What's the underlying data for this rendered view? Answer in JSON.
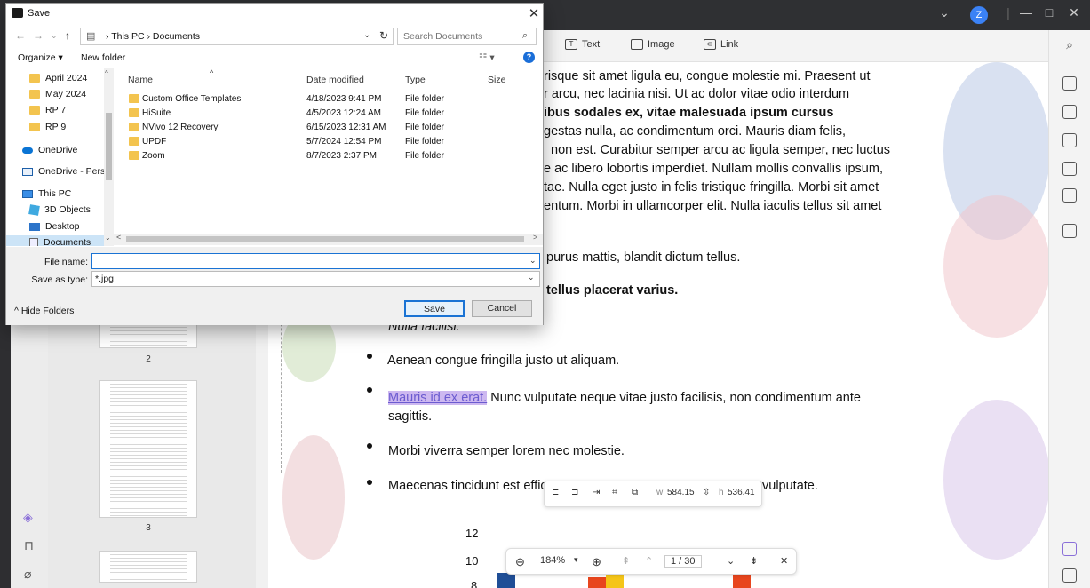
{
  "dialog": {
    "title": "Save",
    "address": {
      "path": "› This PC › Documents",
      "search_placeholder": "Search Documents"
    },
    "commands": {
      "organize": "Organize ▾",
      "new_folder": "New folder"
    },
    "nav_items": [
      {
        "label": "April 2024",
        "icon": "folder-icon"
      },
      {
        "label": "May 2024",
        "icon": "folder-icon"
      },
      {
        "label": "RP 7",
        "icon": "folder-icon"
      },
      {
        "label": "RP 9",
        "icon": "folder-icon"
      },
      {
        "label": "OneDrive",
        "icon": "cloud-icon"
      },
      {
        "label": "OneDrive - Persor",
        "icon": "onedrive-business-icon"
      },
      {
        "label": "This PC",
        "icon": "pc-icon"
      },
      {
        "label": "3D Objects",
        "icon": "cube-icon"
      },
      {
        "label": "Desktop",
        "icon": "desktop-icon"
      },
      {
        "label": "Documents",
        "icon": "documents-icon"
      }
    ],
    "columns": {
      "name": "Name",
      "date": "Date modified",
      "type": "Type",
      "size": "Size"
    },
    "files": [
      {
        "name": "Custom Office Templates",
        "date": "4/18/2023 9:41 PM",
        "type": "File folder"
      },
      {
        "name": "HiSuite",
        "date": "4/5/2023 12:24 AM",
        "type": "File folder"
      },
      {
        "name": "NVivo 12 Recovery",
        "date": "6/15/2023 12:31 AM",
        "type": "File folder"
      },
      {
        "name": "UPDF",
        "date": "5/7/2024 12:54 PM",
        "type": "File folder"
      },
      {
        "name": "Zoom",
        "date": "8/7/2023 2:37 PM",
        "type": "File folder"
      }
    ],
    "file_name_label": "File name:",
    "file_name_value": "",
    "save_as_type_label": "Save as type:",
    "save_as_type_value": "*.jpg",
    "hide_folders": "^ Hide Folders",
    "save_button": "Save",
    "cancel_button": "Cancel"
  },
  "app": {
    "avatar_letter": "Z",
    "toolbar": {
      "text": "Text",
      "image": "Image",
      "link": "Link"
    },
    "thumb_numbers": [
      "2",
      "3"
    ],
    "page_lines": [
      "risque  sit  amet  ligula  eu,  congue  molestie  mi.  Praesent  ut",
      "r  arcu,  nec  lacinia  nisi.  Ut  ac  dolor  vitae  odio  interdum",
      "ibus      sodales      ex,      vitae      malesuada      ipsum      cursus",
      "gestas   nulla,   ac   condimentum   orci.   Mauris   diam   felis,",
      "non  est.  Curabitur  semper  arcu  ac  ligula  semper,  nec  luctus",
      "e  ac  libero  lobortis  imperdiet.  Nullam  mollis  convallis  ipsum,",
      "tae.  Nulla  eget  justo  in  felis  tristique  fringilla.  Morbi  sit  amet",
      "entum.  Morbi  in  ullamcorper  elit.  Nulla  iaculis  tellus  sit amet"
    ],
    "line_purus": "purus mattis, blandit dictum tellus.",
    "line_placerat": "tellus placerat varius.",
    "line_nulla": "Nulla facilisi.",
    "bullet_1": "Aenean congue fringilla justo ut aliquam.",
    "bullet_2_link": "Mauris id ex erat.",
    "bullet_2_rest": " Nunc vulputate neque vitae justo facilisis, non condimentum ante",
    "bullet_2_cont": "sagittis.",
    "bullet_3": "Morbi viverra semper lorem nec molestie.",
    "bullet_4a": "Maecenas tincidunt est effic",
    "bullet_4b": "vulputate.",
    "float_bar": {
      "w_label": "w",
      "w_value": "584.15",
      "h_label": "h",
      "h_value": "536.41"
    },
    "zoom_bar": {
      "zoom": "184%",
      "page": "1 / 30"
    },
    "chart_ticks": [
      "12",
      "10",
      "8"
    ]
  }
}
